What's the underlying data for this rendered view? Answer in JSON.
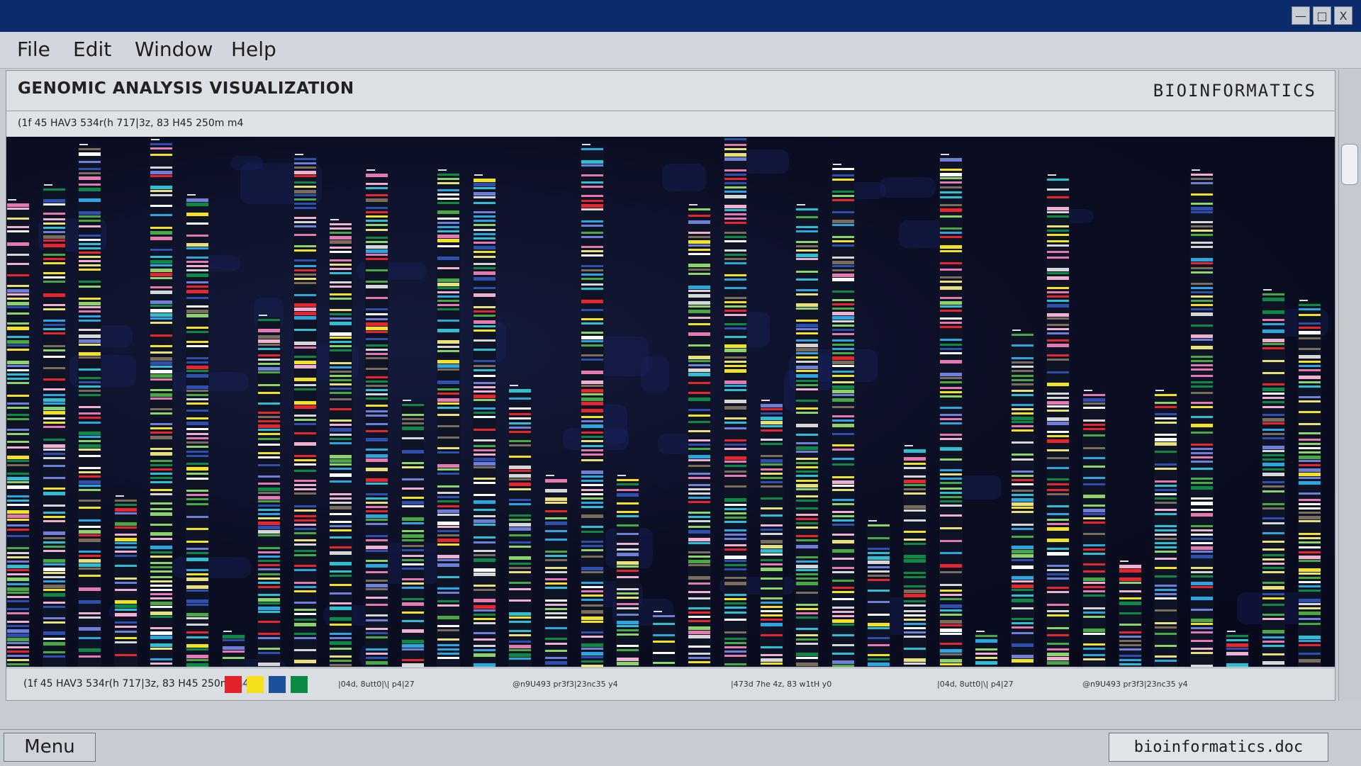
{
  "window": {
    "controls": {
      "minimize": "—",
      "maximize": "□",
      "close": "X"
    }
  },
  "menubar": {
    "items": [
      "File",
      "Edit",
      "Window",
      "Help"
    ]
  },
  "document": {
    "title": "GENOMIC ANALYSIS VISUALIZATION",
    "brand": "BIOINFORMATICS",
    "subheader": "(1f 45 HAV3 534r(h 717|3z, 83 H45 250m m4"
  },
  "legend": {
    "main_label": "(1f 45 HAV3 534r(h 717|3z, 83 H45 250m m4",
    "swatches": [
      {
        "name": "red",
        "color": "#e0232b"
      },
      {
        "name": "yellow",
        "color": "#f4e11a"
      },
      {
        "name": "blue",
        "color": "#1c4f9c"
      },
      {
        "name": "green",
        "color": "#0a8a45"
      }
    ],
    "labels": [
      "|04d, 8utt0|\\| p4|27",
      "@n9U493 pr3f3|23nc35 y4",
      "|473d 7he 4z, 83 w1tH y0",
      "|04d, 8utt0|\\| p4|27",
      "@n9U493 pr3f3|23nc35 y4"
    ]
  },
  "statusbar": {
    "menu_button": "Menu",
    "filename": "bioinformatics.doc"
  },
  "visualization": {
    "palette": [
      "#e8242c",
      "#f2e221",
      "#2aa6e0",
      "#2fbfd2",
      "#48a844",
      "#8bd36a",
      "#e57ab1",
      "#f0b0cf",
      "#ffffff",
      "#d7d7d7",
      "#6f7fd9",
      "#2f4fb0",
      "#7a6d5c",
      "#0b8a46",
      "#e9e07a"
    ],
    "lanes": [
      {
        "start": 0.13
      },
      {
        "start": 0.1
      },
      {
        "start": 0.02
      },
      {
        "start": 0.72
      },
      {
        "start": 0.01
      },
      {
        "start": 0.12
      },
      {
        "start": 0.99
      },
      {
        "start": 0.36
      },
      {
        "start": 0.04
      },
      {
        "start": 0.17
      },
      {
        "start": 0.07
      },
      {
        "start": 0.53
      },
      {
        "start": 0.07
      },
      {
        "start": 0.08
      },
      {
        "start": 0.5
      },
      {
        "start": 0.68
      },
      {
        "start": 0.02
      },
      {
        "start": 0.68
      },
      {
        "start": 0.95
      },
      {
        "start": 0.14
      },
      {
        "start": 0.0
      },
      {
        "start": 0.53
      },
      {
        "start": 0.14
      },
      {
        "start": 0.06
      },
      {
        "start": 0.77
      },
      {
        "start": 0.62
      },
      {
        "start": 0.04
      },
      {
        "start": 0.99
      },
      {
        "start": 0.39
      },
      {
        "start": 0.08
      },
      {
        "start": 0.51
      },
      {
        "start": 0.85
      },
      {
        "start": 0.51
      },
      {
        "start": 0.07
      },
      {
        "start": 0.99
      },
      {
        "start": 0.31
      },
      {
        "start": 0.33
      }
    ]
  }
}
